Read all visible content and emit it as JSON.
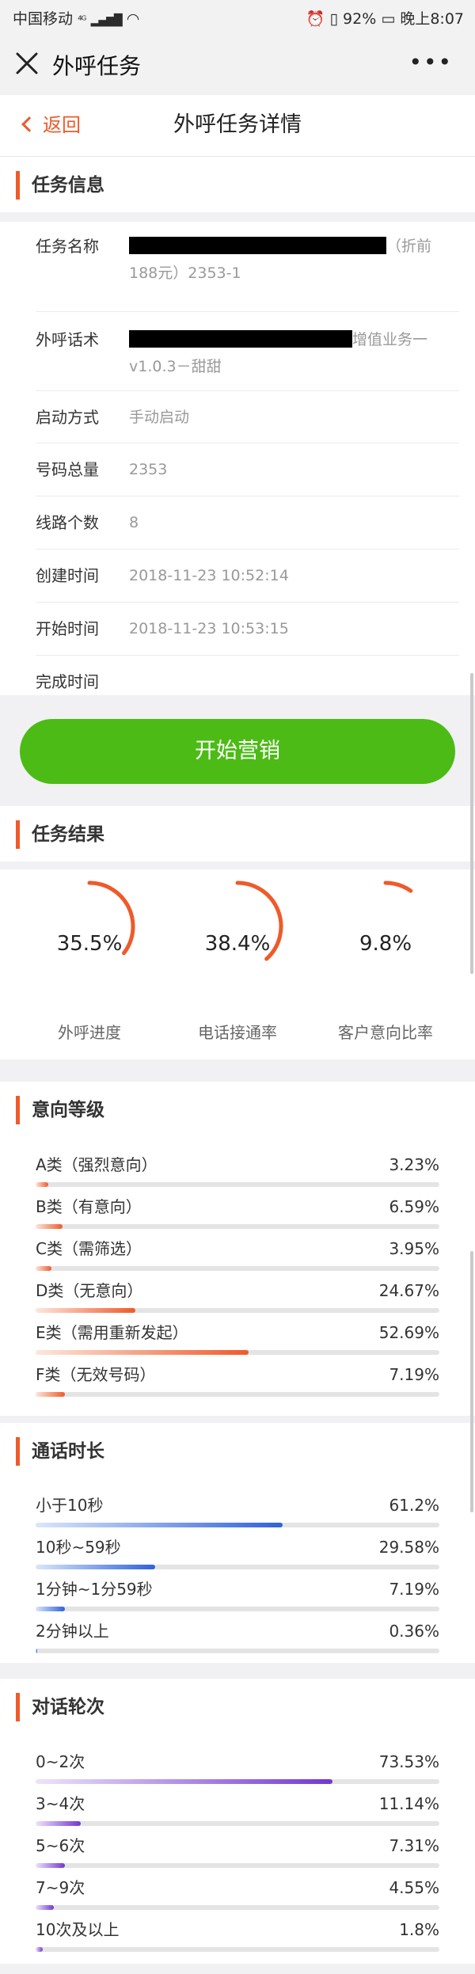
{
  "status_bar": {
    "carrier": "中国移动",
    "network": "⁴ᴳ",
    "battery": "92%",
    "time": "晚上8:07"
  },
  "title_bar": {
    "title": "外呼任务"
  },
  "nav": {
    "back": "返回",
    "title": "外呼任务详情"
  },
  "task_info": {
    "title": "任务信息",
    "rows": [
      {
        "label": "任务名称",
        "value_tail": "（折前",
        "value_line2": "188元）2353-1"
      },
      {
        "label": "外呼话术",
        "value_tail": "增值业务一",
        "value_line2": "v1.0.3－甜甜"
      },
      {
        "label": "启动方式",
        "value": "手动启动"
      },
      {
        "label": "号码总量",
        "value": "2353"
      },
      {
        "label": "线路个数",
        "value": "8"
      },
      {
        "label": "创建时间",
        "value": "2018-11-23 10:52:14"
      },
      {
        "label": "开始时间",
        "value": "2018-11-23 10:53:15"
      },
      {
        "label": "完成时间",
        "value": ""
      }
    ]
  },
  "start_button": {
    "label": "开始营销"
  },
  "task_result": {
    "title": "任务结果",
    "gauges": [
      {
        "value": 35.5,
        "display": "35.5%",
        "label": "外呼进度"
      },
      {
        "value": 38.4,
        "display": "38.4%",
        "label": "电话接通率"
      },
      {
        "value": 9.8,
        "display": "9.8%",
        "label": "客户意向比率"
      }
    ]
  },
  "intent_level": {
    "title": "意向等级",
    "items": [
      {
        "name": "A类（强烈意向）",
        "percent": "3.23%",
        "value": 3.23
      },
      {
        "name": "B类（有意向）",
        "percent": "6.59%",
        "value": 6.59
      },
      {
        "name": "C类（需筛选）",
        "percent": "3.95%",
        "value": 3.95
      },
      {
        "name": "D类（无意向）",
        "percent": "24.67%",
        "value": 24.67
      },
      {
        "name": "E类（需用重新发起）",
        "percent": "52.69%",
        "value": 52.69
      },
      {
        "name": "F类（无效号码）",
        "percent": "7.19%",
        "value": 7.19
      }
    ]
  },
  "call_duration": {
    "title": "通话时长",
    "items": [
      {
        "name": "小于10秒",
        "percent": "61.2%",
        "value": 61.2
      },
      {
        "name": "10秒~59秒",
        "percent": "29.58%",
        "value": 29.58
      },
      {
        "name": "1分钟~1分59秒",
        "percent": "7.19%",
        "value": 7.19
      },
      {
        "name": "2分钟以上",
        "percent": "0.36%",
        "value": 0.36
      }
    ]
  },
  "dialog_rounds": {
    "title": "对话轮次",
    "items": [
      {
        "name": "0~2次",
        "percent": "73.53%",
        "value": 73.53
      },
      {
        "name": "3~4次",
        "percent": "11.14%",
        "value": 11.14
      },
      {
        "name": "5~6次",
        "percent": "7.31%",
        "value": 7.31
      },
      {
        "name": "7~9次",
        "percent": "4.55%",
        "value": 4.55
      },
      {
        "name": "10次及以上",
        "percent": "1.8%",
        "value": 1.8
      }
    ]
  },
  "colors": {
    "accent": "#ef5a2a",
    "green": "#4cbb16",
    "blue": "#2f62db",
    "purple": "#7237d1"
  }
}
